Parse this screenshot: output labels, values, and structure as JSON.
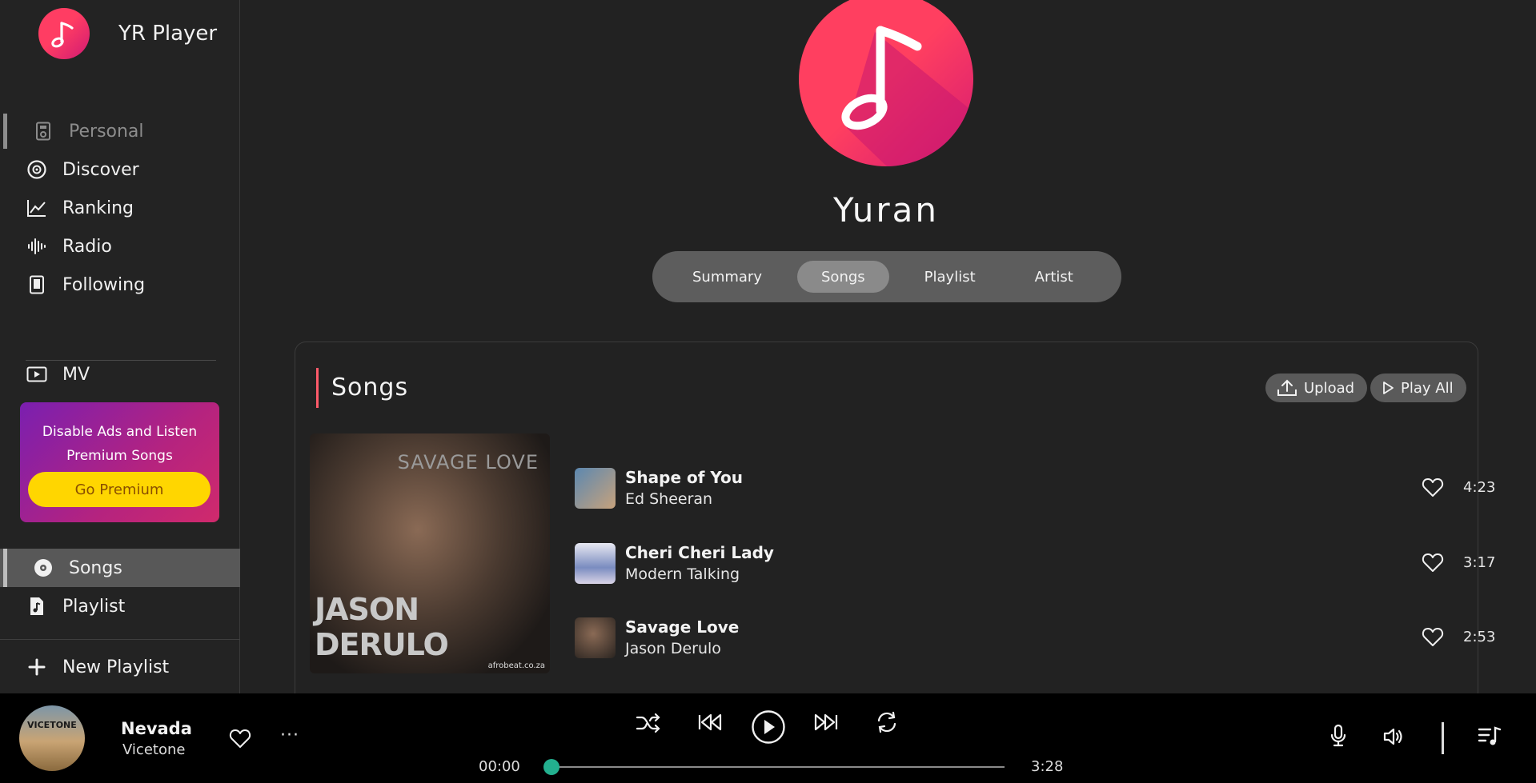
{
  "app": {
    "name": "YR Player"
  },
  "sidebar": {
    "nav": [
      {
        "label": "Personal",
        "icon": "personal-icon",
        "active": true
      },
      {
        "label": "Discover",
        "icon": "discover-icon"
      },
      {
        "label": "Ranking",
        "icon": "ranking-icon"
      },
      {
        "label": "Radio",
        "icon": "radio-icon"
      },
      {
        "label": "Following",
        "icon": "following-icon"
      }
    ],
    "mv": {
      "label": "MV",
      "icon": "video-icon"
    },
    "premium": {
      "line1": "Disable Ads and Listen",
      "line2": "Premium Songs",
      "button": "Go Premium"
    },
    "library": [
      {
        "label": "Songs",
        "icon": "disc-icon",
        "selected": true
      },
      {
        "label": "Playlist",
        "icon": "music-file-icon"
      }
    ],
    "new_playlist": "New Playlist"
  },
  "profile": {
    "name": "Yuran",
    "tabs": [
      {
        "label": "Summary"
      },
      {
        "label": "Songs",
        "selected": true
      },
      {
        "label": "Playlist"
      },
      {
        "label": "Artist"
      }
    ]
  },
  "songs_section": {
    "title": "Songs",
    "upload_label": "Upload",
    "play_all_label": "Play All",
    "album": {
      "top_text": "SAVAGE LOVE",
      "bottom_text": "JASON DERULO",
      "credit": "afrobeat.co.za"
    },
    "songs": [
      {
        "title": "Shape of You",
        "artist": "Ed Sheeran",
        "duration": "4:23"
      },
      {
        "title": "Cheri Cheri Lady",
        "artist": "Modern Talking",
        "duration": "3:17"
      },
      {
        "title": "Savage Love",
        "artist": "Jason Derulo",
        "duration": "2:53"
      }
    ]
  },
  "player": {
    "cover_text": "VICETONE",
    "title": "Nevada",
    "artist": "Vicetone",
    "more_label": "···",
    "current_time": "00:00",
    "total_time": "3:28",
    "progress": 0,
    "accent_color": "#23b08f"
  },
  "colors": {
    "brand_pink": "#ff3d63",
    "brand_magenta": "#d01a73",
    "premium_gradient_start": "#7a1fb0",
    "premium_gradient_end": "#d02a6c",
    "premium_button": "#ffd600"
  }
}
